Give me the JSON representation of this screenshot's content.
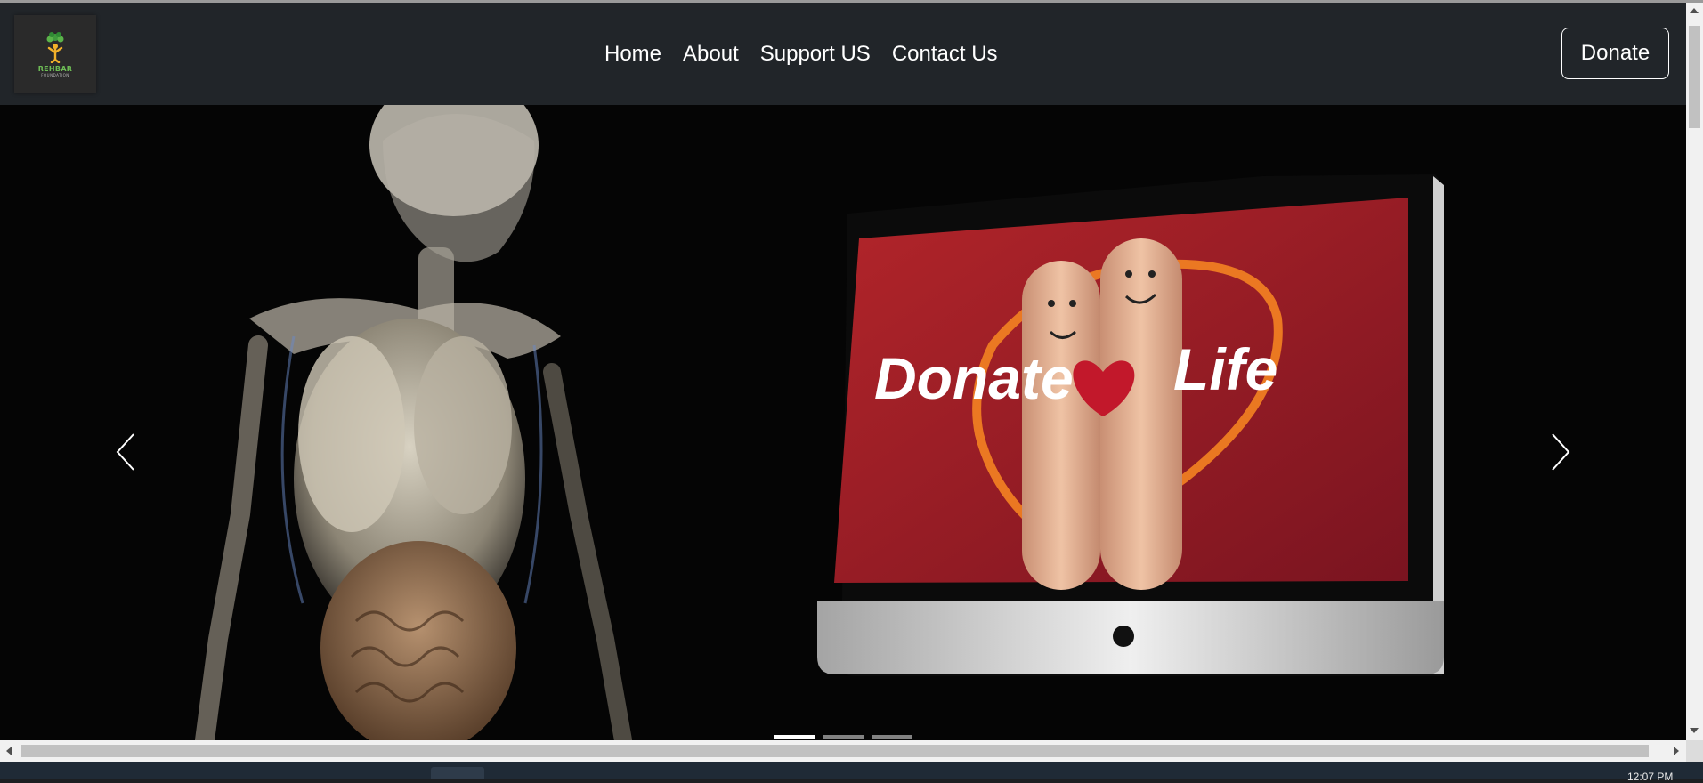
{
  "logo": {
    "name": "REHBAR",
    "tagline": "FOUNDATION"
  },
  "nav": {
    "items": [
      {
        "label": "Home"
      },
      {
        "label": "About"
      },
      {
        "label": "Support US"
      },
      {
        "label": "Contact Us"
      }
    ],
    "donate_label": "Donate"
  },
  "hero": {
    "slide_text_left": "Donate",
    "slide_text_right": "Life",
    "slide_count": 3,
    "active_slide": 1
  },
  "taskbar": {
    "clock": "12:07 PM"
  },
  "colors": {
    "navbar": "#212529",
    "hero_bg": "#050505",
    "screen_red": "#b3252a",
    "heart_orange": "#ef7d22"
  }
}
